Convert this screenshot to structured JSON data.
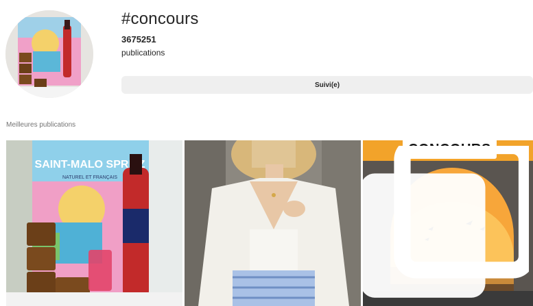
{
  "header": {
    "title": "#concours",
    "count": "3675251",
    "count_label": "publications",
    "follow_label": "Suivi(e)"
  },
  "section": {
    "top_posts_label": "Meilleures publications"
  },
  "posts": [
    {
      "poster_text": "SAINT-MALO SPRITZ",
      "poster_subtext": "NATUREL ET FRANÇAIS"
    },
    {},
    {
      "badge": "CONCOURS"
    }
  ],
  "colors": {
    "button_bg": "#efefef",
    "text": "#262626",
    "muted": "#737373"
  }
}
